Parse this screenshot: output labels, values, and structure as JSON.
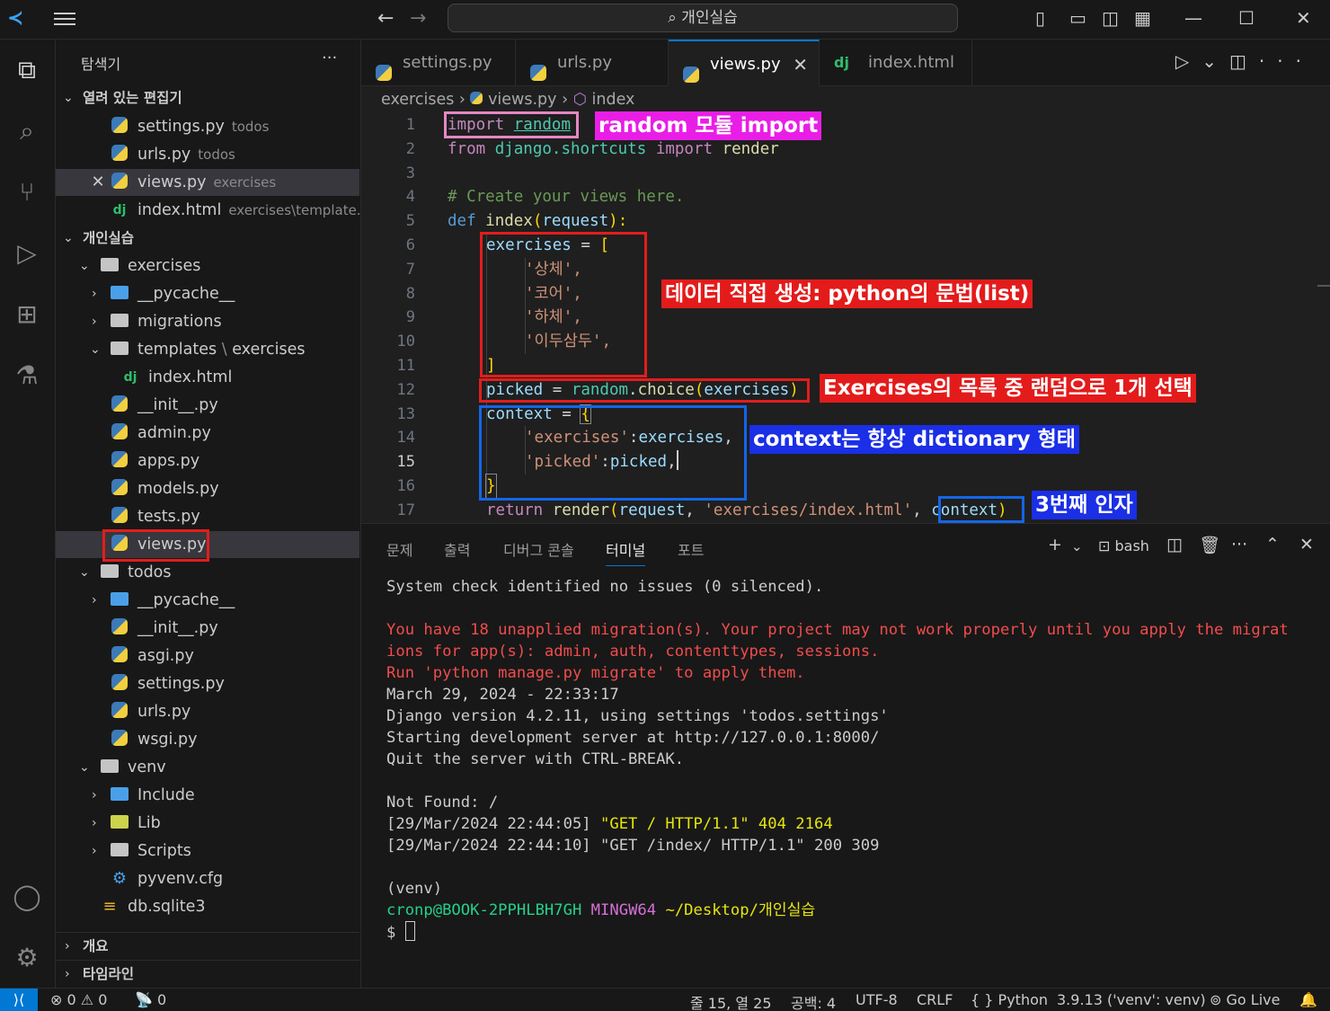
{
  "titlebar": {
    "search": "개인실습",
    "back": "←",
    "forward": "→"
  },
  "sidebar": {
    "title": "탐색기",
    "more": "···",
    "open_editors_header": "열려 있는 편집기",
    "open_editors": [
      {
        "name": "settings.py",
        "desc": "todos"
      },
      {
        "name": "urls.py",
        "desc": "todos"
      },
      {
        "name": "views.py",
        "desc": "exercises"
      },
      {
        "name": "index.html",
        "desc": "exercises\\template..."
      }
    ],
    "workspace_header": "개인실습",
    "tree": [
      {
        "name": "exercises"
      },
      {
        "name": "__pycache__"
      },
      {
        "name": "migrations"
      },
      {
        "name": "templates",
        "sep": "\\",
        "name2": "exercises"
      },
      {
        "name": "index.html"
      },
      {
        "name": "__init__.py"
      },
      {
        "name": "admin.py"
      },
      {
        "name": "apps.py"
      },
      {
        "name": "models.py"
      },
      {
        "name": "tests.py"
      },
      {
        "name": "views.py"
      },
      {
        "name": "todos"
      },
      {
        "name": "__pycache__"
      },
      {
        "name": "__init__.py"
      },
      {
        "name": "asgi.py"
      },
      {
        "name": "settings.py"
      },
      {
        "name": "urls.py"
      },
      {
        "name": "wsgi.py"
      },
      {
        "name": "venv"
      },
      {
        "name": "Include"
      },
      {
        "name": "Lib"
      },
      {
        "name": "Scripts"
      },
      {
        "name": "pyvenv.cfg"
      },
      {
        "name": "db.sqlite3"
      }
    ],
    "outline_header": "개요",
    "timeline_header": "타임라인"
  },
  "tabs": [
    {
      "label": "settings.py"
    },
    {
      "label": "urls.py"
    },
    {
      "label": "views.py",
      "close": "✕"
    },
    {
      "label": "index.html"
    }
  ],
  "breadcrumb": {
    "folder": "exercises",
    "file": "views.py",
    "symbol": "index"
  },
  "editor": {
    "current_line": 15,
    "line_numbers": [
      "1",
      "2",
      "3",
      "4",
      "5",
      "6",
      "7",
      "8",
      "9",
      "10",
      "11",
      "12",
      "13",
      "14",
      "15",
      "16",
      "17"
    ],
    "lines": {
      "l1": [
        "import",
        " ",
        "random"
      ],
      "l2": [
        "from",
        " django.shortcuts ",
        "import",
        " render"
      ],
      "l4": "# Create your views here.",
      "l5": [
        "def",
        " ",
        "index",
        "(",
        "request",
        "):"
      ],
      "l6": [
        "exercises",
        " = ",
        "["
      ],
      "l7": "'상체',",
      "l8": "'코어',",
      "l9": "'하체',",
      "l10": "'이두삼두',",
      "l11": "]",
      "l12": [
        "picked",
        " = ",
        "random",
        ".",
        "choice",
        "(",
        "exercises",
        ")"
      ],
      "l13": [
        "context",
        " = ",
        "{"
      ],
      "l14": [
        "'exercises'",
        ":",
        "exercises",
        ","
      ],
      "l15": [
        "'picked'",
        ":",
        "picked",
        ","
      ],
      "l16": "}",
      "l17": [
        "return",
        " ",
        "render",
        "(",
        "request",
        ", ",
        "'exercises/index.html'",
        ", ",
        "context",
        ")"
      ]
    }
  },
  "annotations": {
    "a1": "random 모듈 import",
    "a2": "데이터 직접 생성: python의 문법(list)",
    "a3": "Exercises의 목록 중 랜덤으로 1개 선택",
    "a4": "context는 항상 dictionary 형태",
    "a5": "3번째 인자"
  },
  "panel": {
    "tabs": [
      "문제",
      "출력",
      "디버그 콘솔",
      "터미널",
      "포트"
    ],
    "active_tab": "터미널",
    "shell": "bash",
    "terminal": {
      "t1": "System check identified no issues (0 silenced).",
      "t2": "You have 18 unapplied migration(s). Your project may not work properly until you apply the migrat",
      "t3": "ions for app(s): admin, auth, contenttypes, sessions.",
      "t4": "Run 'python manage.py migrate' to apply them.",
      "t5": "March 29, 2024 - 22:33:17",
      "t6": "Django version 4.2.11, using settings 'todos.settings'",
      "t7": "Starting development server at http://127.0.0.1:8000/",
      "t8": "Quit the server with CTRL-BREAK.",
      "t9": "Not Found: /",
      "t10a": "[29/Mar/2024 22:44:05] ",
      "t10b": "\"GET / HTTP/1.1\" 404 2164",
      "t11": "[29/Mar/2024 22:44:10] \"GET /index/ HTTP/1.1\" 200 309",
      "t12": "(venv)",
      "t13a": "cronp@BOOK-2PPHLBH7GH",
      "t13b": "MINGW64",
      "t13c": "~/Desktop/개인실습",
      "t14": "$"
    }
  },
  "statusbar": {
    "errors": "0",
    "warnings": "0",
    "ports": "0",
    "position": "줄 15, 열 25",
    "spaces": "공백: 4",
    "encoding": "UTF-8",
    "eol": "CRLF",
    "language": "Python",
    "interpreter": "3.9.13 ('venv': venv)",
    "golive": "Go Live"
  },
  "colors": {
    "accent": "#0078d4",
    "annotation_red": "#e31b1b",
    "annotation_blue": "#1a2fe6",
    "annotation_magenta": "#e91ee6"
  }
}
